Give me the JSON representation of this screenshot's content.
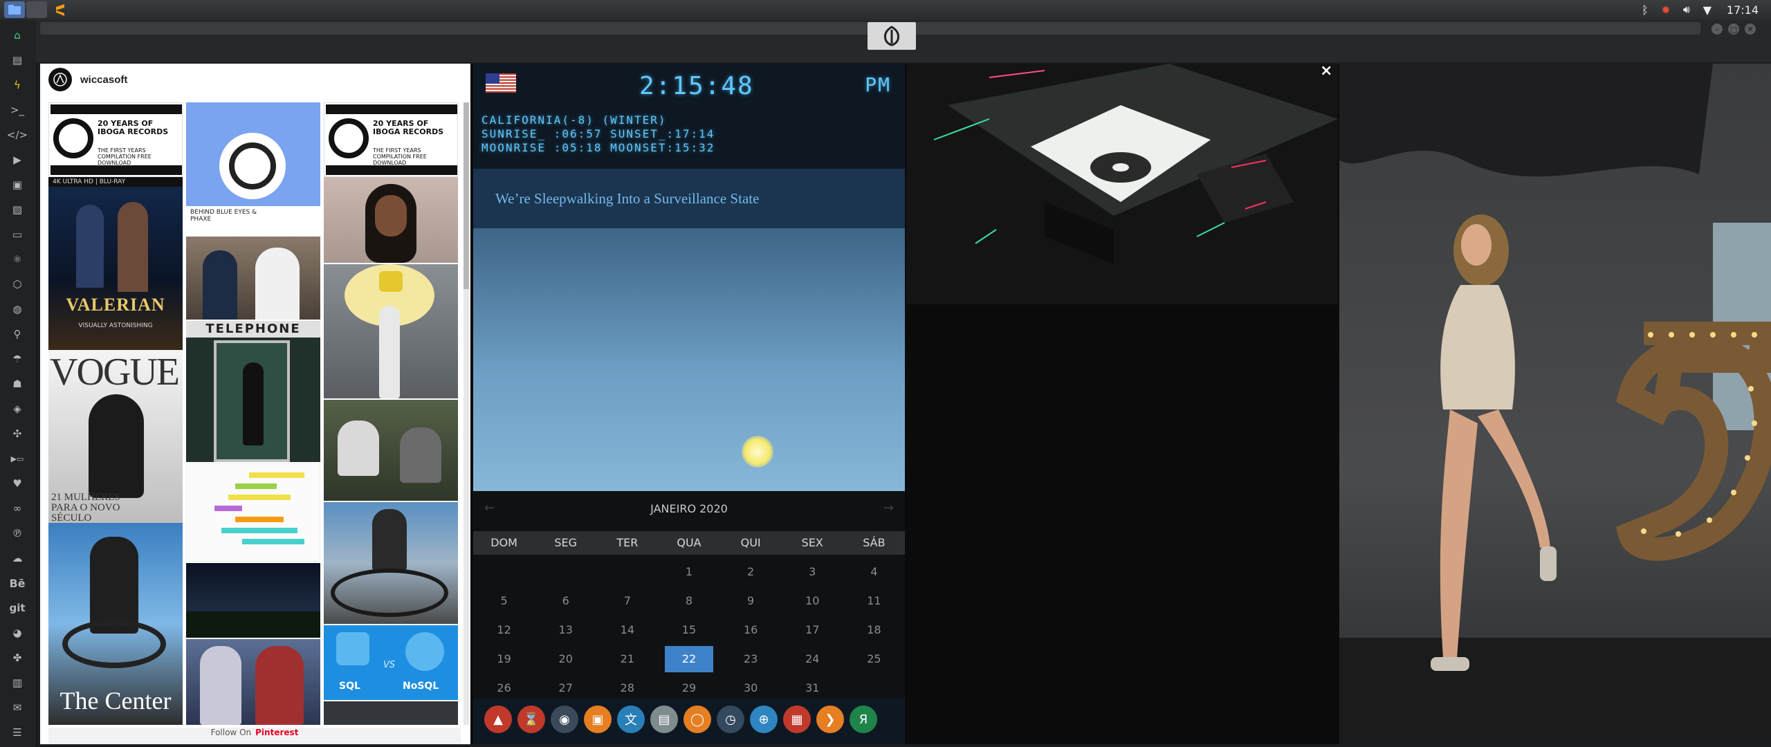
{
  "colors": {
    "accent_cyan": "#5fc8ff",
    "headline_bg": "#1b3550",
    "today_bg": "#3e83c9",
    "pinterest_red": "#e60023"
  },
  "system_tray": {
    "clock": "17:14",
    "icons": [
      "bluetooth-icon",
      "network-alert-icon",
      "volume-icon",
      "wifi-icon"
    ]
  },
  "taskbar": {
    "apps": [
      "files-icon",
      "blank-app-icon",
      "sublime-icon"
    ]
  },
  "sidebar": {
    "items": [
      "home-icon",
      "document-icon",
      "flash-icon",
      "terminal-icon",
      "code-icon",
      "play-icon",
      "video-icon",
      "image-icon",
      "card-icon",
      "react-icon",
      "hexagon-icon",
      "globe-icon",
      "search-icon",
      "umbrella-icon",
      "contact-icon",
      "tag-icon",
      "expand-icon",
      "youtube-icon",
      "heart-icon",
      "link-icon",
      "pinterest-icon",
      "cloud-icon",
      "behance-icon",
      "git-icon",
      "github-icon",
      "puzzle-icon",
      "map-icon",
      "mail-icon",
      "server-icon"
    ],
    "labels": {
      "behance": "Bē",
      "git": "git"
    }
  },
  "pinterest": {
    "profile_name": "wiccasoft",
    "tiles": {
      "iboga1": "20 YEARS OF IBOGA RECORDS",
      "iboga_sub": "THE FIRST YEARS COMPILATION FREE DOWNLOAD",
      "valerian": "VALERIAN",
      "valerian_top": "4K ULTRA HD | BLU-RAY",
      "valerian_tag": "VISUALLY ASTONISHING",
      "vogue": "VOGUE",
      "vogue_sub": "21 MULHERES PARA O NOVO SÉCULO",
      "center": "The Center",
      "blue_eyes": "BEHIND BLUE EYES & PHAXE",
      "telephone": "TELEPHONE",
      "sql": "SQL",
      "vs": "VS",
      "nosql": "NoSQL"
    },
    "footer_prefix": "Follow On",
    "footer_brand": "Pinterest"
  },
  "clock_panel": {
    "time": "2:15:48",
    "ampm": "PM",
    "location": "CALIFORNIA(-8) (WINTER)",
    "sun_line": "SUNRISE_ :06:57 SUNSET_:17:14",
    "moon_line": "MOONRISE :05:18 MOONSET:15:32",
    "headline": "We’re Sleepwalking Into a Surveillance State"
  },
  "calendar": {
    "month": "JANEIRO 2020",
    "weekdays": [
      "DOM",
      "SEG",
      "TER",
      "QUA",
      "QUI",
      "SEX",
      "SÁB"
    ],
    "weeks": [
      [
        "",
        "",
        "",
        "1",
        "2",
        "3",
        "4"
      ],
      [
        "5",
        "6",
        "7",
        "8",
        "9",
        "10",
        "11"
      ],
      [
        "12",
        "13",
        "14",
        "15",
        "16",
        "17",
        "18"
      ],
      [
        "19",
        "20",
        "21",
        "22",
        "23",
        "24",
        "25"
      ],
      [
        "26",
        "27",
        "28",
        "29",
        "30",
        "31",
        ""
      ]
    ],
    "today": "22",
    "prev": "←",
    "next": "→"
  },
  "dock": {
    "apps": [
      {
        "icon": "triangle-app-icon",
        "color": "#c0392b",
        "glyph": "▲"
      },
      {
        "icon": "hourglass-icon",
        "color": "#c0392b",
        "glyph": "⌛"
      },
      {
        "icon": "globe-dark-icon",
        "color": "#3b4a5a",
        "glyph": "◉"
      },
      {
        "icon": "photos-icon",
        "color": "#e67e22",
        "glyph": "▣"
      },
      {
        "icon": "translate-icon",
        "color": "#2980b9",
        "glyph": "文"
      },
      {
        "icon": "notes-icon",
        "color": "#7f8c8d",
        "glyph": "▤"
      },
      {
        "icon": "search-app-icon",
        "color": "#e67e22",
        "glyph": "◯"
      },
      {
        "icon": "clock-app-icon",
        "color": "#34495e",
        "glyph": "◷"
      },
      {
        "icon": "browser-icon",
        "color": "#2e86c1",
        "glyph": "⊕"
      },
      {
        "icon": "calendar-app-icon",
        "color": "#c0392b",
        "glyph": "▦"
      },
      {
        "icon": "sublime-dock-icon",
        "color": "#e67e22",
        "glyph": "❯"
      },
      {
        "icon": "yandex-icon",
        "color": "#1e8449",
        "glyph": "Я"
      }
    ]
  },
  "window": {
    "close": "×"
  }
}
